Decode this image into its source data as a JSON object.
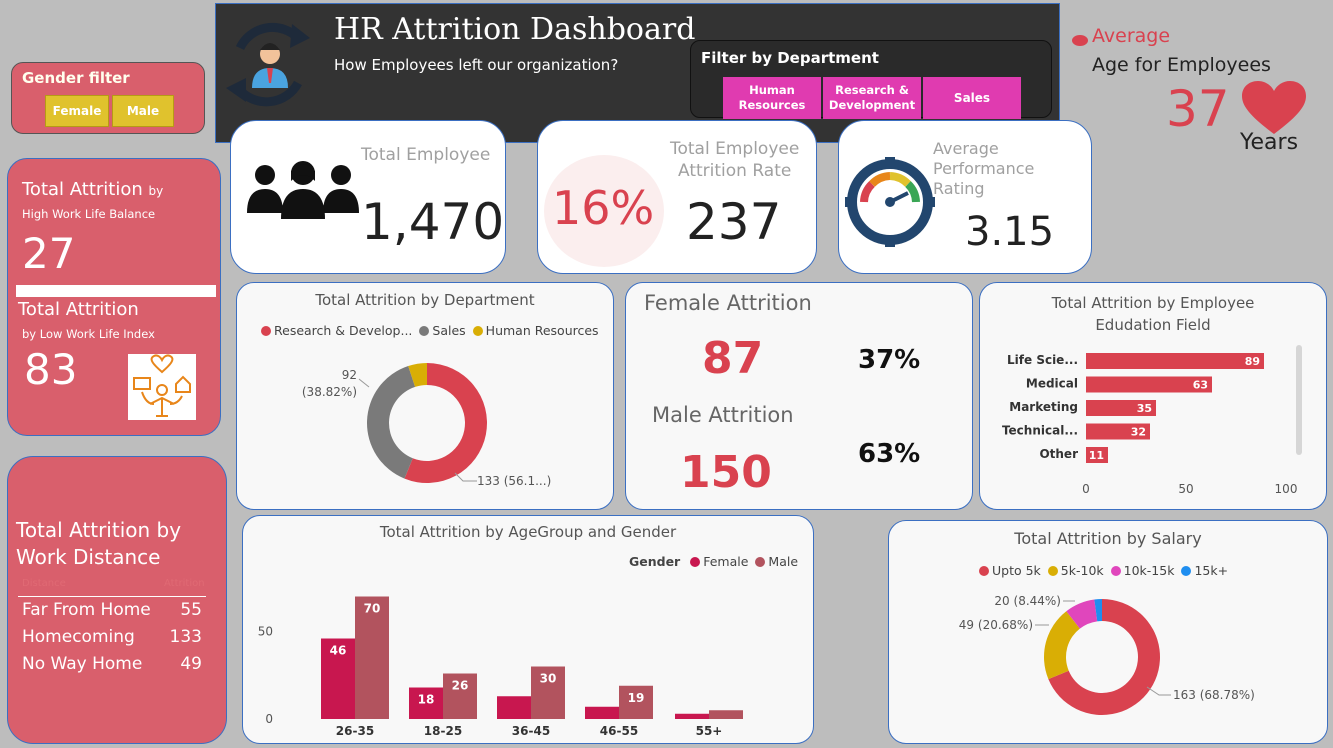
{
  "header": {
    "title": "HR Attrition Dashboard",
    "subtitle": "How Employees left our organization?",
    "icon": "employee-cycle-icon"
  },
  "department_filter": {
    "label": "Filter by Department",
    "buttons": [
      "Human Resources",
      "Research & Development",
      "Sales"
    ]
  },
  "gender_filter": {
    "label": "Gender filter",
    "buttons": [
      "Female",
      "Male"
    ]
  },
  "average_age": {
    "label1": "Average",
    "label2": "Age for Employees",
    "value": "37",
    "unit": "Years"
  },
  "wlb": {
    "title1": "Total Attrition",
    "title1_suffix": "by",
    "sub1": "High Work Life Balance",
    "value1": "27",
    "title2": "Total Attrition",
    "sub2": "by Low Work Life Index",
    "value2": "83"
  },
  "kpi_employees": {
    "label": "Total Employee",
    "value": "1,470"
  },
  "kpi_attrition": {
    "label1": "Total Employee",
    "label2": "Attrition Rate",
    "rate": "16%",
    "value": "237"
  },
  "kpi_perf": {
    "label1": "Average",
    "label2": "Performance",
    "label3": "Rating",
    "value": "3.15"
  },
  "gender_attrition": {
    "female_label": "Female Attrition",
    "female_value": "87",
    "female_pct": "37%",
    "male_label": "Male Attrition",
    "male_value": "150",
    "male_pct": "63%"
  },
  "distance": {
    "title": "Total Attrition by Work Distance",
    "header_left": "Distance",
    "header_right": "Attrition",
    "rows": [
      {
        "label": "Far From Home",
        "value": "55"
      },
      {
        "label": "Homecoming",
        "value": "133"
      },
      {
        "label": "No Way Home",
        "value": "49"
      }
    ]
  },
  "colors": {
    "accent_red": "#d9424f",
    "female": "#c8174f",
    "male": "#b2535e",
    "grey": "#7a7a7a",
    "yellow": "#d9ae05",
    "pink": "#e046bc",
    "blue": "#1f8ef0",
    "header_bg": "#333333",
    "filter_pink": "#e03bb0",
    "gender_btn": "#e0c22d"
  },
  "chart_data": [
    {
      "id": "dept",
      "type": "pie",
      "title": "Total Attrition by Department",
      "categories": [
        "Research & Develop...",
        "Sales",
        "Human Resources"
      ],
      "values": [
        133,
        92,
        12
      ],
      "data_labels": [
        "133 (56.1...)",
        "92\n(38.82%)",
        ""
      ],
      "legend": "top"
    },
    {
      "id": "edu",
      "type": "bar",
      "title": "Total Attrition by Employee Edudation Field",
      "categories": [
        "Life Scie...",
        "Medical",
        "Marketing",
        "Technical...",
        "Other"
      ],
      "values": [
        89,
        63,
        35,
        32,
        11
      ],
      "xlim": [
        0,
        100
      ],
      "xticks": [
        "0",
        "50",
        "100"
      ]
    },
    {
      "id": "age",
      "type": "bar",
      "title": "Total Attrition by AgeGroup and Gender",
      "legend_title": "Gender",
      "categories": [
        "26-35",
        "18-25",
        "36-45",
        "46-55",
        "55+"
      ],
      "series": [
        {
          "name": "Female",
          "values": [
            46,
            18,
            13,
            7,
            3
          ]
        },
        {
          "name": "Male",
          "values": [
            70,
            26,
            30,
            19,
            5
          ]
        }
      ],
      "data_labels": {
        "Female": [
          "46",
          "18",
          "",
          "",
          ""
        ],
        "Male": [
          "70",
          "26",
          "30",
          "19",
          ""
        ]
      },
      "ylim": [
        0,
        80
      ],
      "yticks": [
        "0",
        "50"
      ]
    },
    {
      "id": "salary",
      "type": "pie",
      "title": "Total Attrition by Salary",
      "categories": [
        "Upto 5k",
        "5k-10k",
        "10k-15k",
        "15k+"
      ],
      "values": [
        163,
        49,
        20,
        5
      ],
      "data_labels": [
        "163 (68.78%)",
        "49 (20.68%)",
        "20 (8.44%)",
        ""
      ],
      "legend": "top"
    }
  ]
}
